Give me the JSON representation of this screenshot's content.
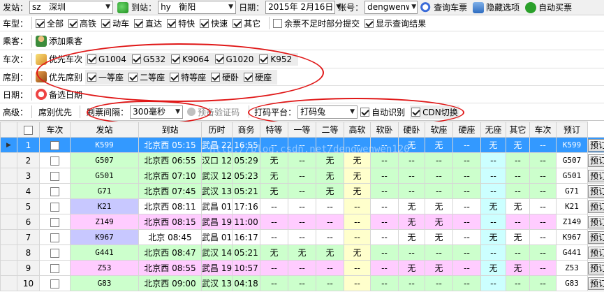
{
  "row1": {
    "from_label": "发站",
    "from_code": "sz",
    "from_city": "深圳",
    "to_label": "到站",
    "to_code": "hy",
    "to_city": "衡阳",
    "date_label": "日期",
    "date_value": "2015年 2月16日",
    "account_label": "账号",
    "account_value": "dengwenw",
    "query_button": "查询车票",
    "hide_button": "隐藏选项",
    "auto_button": "自动买票"
  },
  "row2": {
    "label": "车型",
    "types": [
      {
        "label": "全部",
        "checked": true
      },
      {
        "label": "高铁",
        "checked": true
      },
      {
        "label": "动车",
        "checked": true
      },
      {
        "label": "直达",
        "checked": true
      },
      {
        "label": "特快",
        "checked": true
      },
      {
        "label": "快速",
        "checked": true
      },
      {
        "label": "其它",
        "checked": true
      }
    ],
    "partial_submit": {
      "label": "余票不足时部分提交",
      "checked": false
    },
    "show_results": {
      "label": "显示查询结果",
      "checked": true
    }
  },
  "row3": {
    "label": "乘客",
    "add_passenger": "添加乘客"
  },
  "row4": {
    "label": "车次",
    "priority_button": "优先车次",
    "trains": [
      {
        "label": "G1004",
        "checked": true
      },
      {
        "label": "G532",
        "checked": true
      },
      {
        "label": "K9064",
        "checked": true
      },
      {
        "label": "G1020",
        "checked": true
      },
      {
        "label": "K952",
        "checked": true
      }
    ]
  },
  "row5": {
    "label": "席别",
    "priority_button": "优先席别",
    "seats": [
      {
        "label": "一等座",
        "checked": true
      },
      {
        "label": "二等座",
        "checked": true
      },
      {
        "label": "特等座",
        "checked": true
      },
      {
        "label": "硬卧",
        "checked": true
      },
      {
        "label": "硬座",
        "checked": true
      }
    ]
  },
  "row6": {
    "label": "日期",
    "backup_dates": "备选日期"
  },
  "row7": {
    "label": "高级",
    "seat_priority": "席别优先",
    "refresh_label": "刷票间隔：",
    "refresh_value": "300毫秒",
    "captcha_label": "预备验证码",
    "platform_label": "打码平台：",
    "platform_value": "打码兔",
    "auto_recognize": {
      "label": "自动识别",
      "checked": true
    },
    "cdn_switch": {
      "label": "CDN切换",
      "checked": true
    }
  },
  "watermark": "http://blog.csdn.net/dengwenwen120",
  "colors": {
    "selected_row": "#3399ff",
    "row_green": "#ccffcc",
    "row_pink": "#ffccff",
    "row_white": "#ffffff",
    "train_purple": "#c8c8ff",
    "col_yellow": "#ffffcc",
    "col_cyan": "#ccffff",
    "annotation": "#e01818"
  },
  "table": {
    "headers": [
      "",
      "车次",
      "发站",
      "到站",
      "历时",
      "商务",
      "特等",
      "一等",
      "二等",
      "高软",
      "软卧",
      "硬卧",
      "软座",
      "硬座",
      "无座",
      "其它",
      "车次",
      "预订"
    ],
    "rows": [
      {
        "num": "1",
        "train": "K599",
        "from": "北京西 05:15",
        "to": "武昌 22:10",
        "dur": "16:55",
        "seats": [
          "--",
          "--",
          "--",
          "--",
          "--",
          "无",
          "无",
          "--",
          "无",
          "无",
          "--"
        ],
        "train2": "K599",
        "book": "预订",
        "tone": "sel"
      },
      {
        "num": "2",
        "train": "G507",
        "from": "北京西 06:55",
        "to": "汉口 12:24",
        "dur": "05:29",
        "seats": [
          "无",
          "--",
          "无",
          "无",
          "--",
          "--",
          "--",
          "--",
          "--",
          "--",
          "--"
        ],
        "train2": "G507",
        "book": "预订",
        "tone": "green"
      },
      {
        "num": "3",
        "train": "G501",
        "from": "北京西 07:10",
        "to": "武汉 12:33",
        "dur": "05:23",
        "seats": [
          "无",
          "--",
          "无",
          "无",
          "--",
          "--",
          "--",
          "--",
          "--",
          "--",
          "--"
        ],
        "train2": "G501",
        "book": "预订",
        "tone": "green"
      },
      {
        "num": "4",
        "train": "G71",
        "from": "北京西 07:45",
        "to": "武汉 13:06",
        "dur": "05:21",
        "seats": [
          "无",
          "--",
          "无",
          "无",
          "--",
          "--",
          "--",
          "--",
          "--",
          "--",
          "--"
        ],
        "train2": "G71",
        "book": "预订",
        "tone": "green"
      },
      {
        "num": "5",
        "train": "K21",
        "from": "北京西 08:11",
        "to": "武昌 01:27",
        "dur": "17:16",
        "seats": [
          "--",
          "--",
          "--",
          "--",
          "--",
          "无",
          "无",
          "--",
          "无",
          "无",
          "--"
        ],
        "train2": "K21",
        "book": "预订",
        "tone": "white"
      },
      {
        "num": "6",
        "train": "Z149",
        "from": "北京西 08:15",
        "to": "武昌 19:45",
        "dur": "11:00",
        "seats": [
          "--",
          "--",
          "--",
          "--",
          "--",
          "无",
          "无",
          "--",
          "--",
          "--",
          "--"
        ],
        "train2": "Z149",
        "book": "预订",
        "tone": "pink"
      },
      {
        "num": "7",
        "train": "K967",
        "from": "北京 08:45",
        "to": "武昌 01:02",
        "dur": "16:17",
        "seats": [
          "--",
          "--",
          "--",
          "--",
          "--",
          "无",
          "无",
          "--",
          "无",
          "无",
          "--"
        ],
        "train2": "K967",
        "book": "预订",
        "tone": "white"
      },
      {
        "num": "8",
        "train": "G441",
        "from": "北京西 08:47",
        "to": "武汉 14:08",
        "dur": "05:21",
        "seats": [
          "无",
          "无",
          "无",
          "无",
          "--",
          "--",
          "--",
          "--",
          "--",
          "--",
          "--"
        ],
        "train2": "G441",
        "book": "预订",
        "tone": "green"
      },
      {
        "num": "9",
        "train": "Z53",
        "from": "北京西 08:55",
        "to": "武昌 19:52",
        "dur": "10:57",
        "seats": [
          "--",
          "--",
          "--",
          "--",
          "--",
          "无",
          "无",
          "--",
          "无",
          "无",
          "--"
        ],
        "train2": "Z53",
        "book": "预订",
        "tone": "pink"
      },
      {
        "num": "10",
        "train": "G83",
        "from": "北京西 09:00",
        "to": "武汉 13:18",
        "dur": "04:18",
        "seats": [
          "--",
          "--",
          "--",
          "--",
          "--",
          "--",
          "--",
          "--",
          "--",
          "--",
          "--"
        ],
        "train2": "G83",
        "book": "预订",
        "tone": "green"
      }
    ]
  }
}
